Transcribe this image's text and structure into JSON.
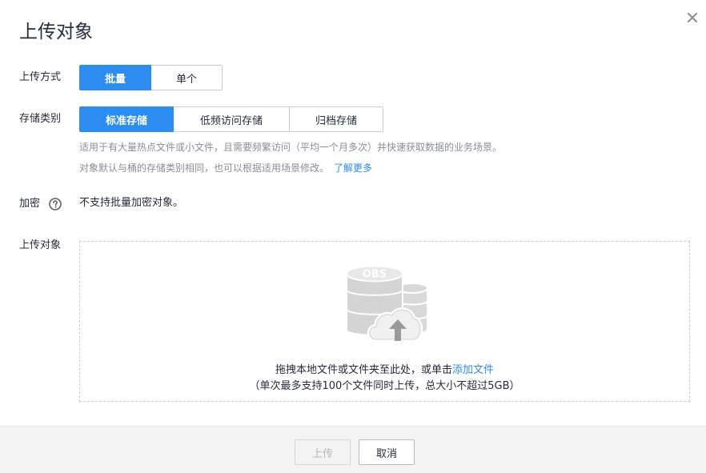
{
  "dialog": {
    "title": "上传对象",
    "close_icon": "close-icon"
  },
  "upload_mode": {
    "label": "上传方式",
    "options": [
      "批量",
      "单个"
    ],
    "selected": "批量"
  },
  "storage_class": {
    "label": "存储类别",
    "options": [
      "标准存储",
      "低频访问存储",
      "归档存储"
    ],
    "selected": "标准存储",
    "hint_line1": "适用于有大量热点文件或小文件，且需要频繁访问（平均一个月多次）并快速获取数据的业务场景。",
    "hint_line2": "对象默认与桶的存储类别相同，也可以根据适用场景修改。",
    "learn_more": "了解更多"
  },
  "encryption": {
    "label": "加密",
    "help_icon": "help-icon",
    "value": "不支持批量加密对象。"
  },
  "upload_object": {
    "label": "上传对象",
    "illustration_text": "OBS",
    "drop_text": "拖拽本地文件或文件夹至此处，或单击",
    "add_file_link": "添加文件",
    "limit_text": "（单次最多支持100个文件同时上传，总大小不超过5GB）"
  },
  "footer": {
    "upload_label": "上传",
    "cancel_label": "取消"
  },
  "colors": {
    "accent": "#2d8cf0",
    "text": "#252b3a",
    "hint": "#8a8e99",
    "footer_bg": "#f3f3f3"
  }
}
